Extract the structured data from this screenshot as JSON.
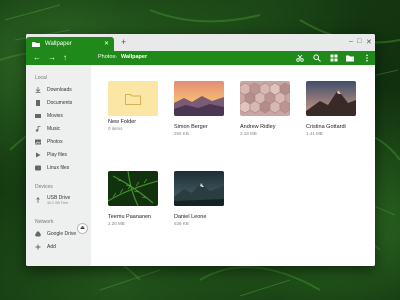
{
  "tab": {
    "title": "Wallpaper",
    "close": "✕"
  },
  "new_tab": "+",
  "window_controls": {
    "minimize": "–",
    "maximize": "□",
    "close": "✕"
  },
  "toolbar": {
    "back": "←",
    "forward": "→",
    "up": "↑",
    "breadcrumbs": [
      "Photos",
      "Wallpaper"
    ],
    "sep": "›"
  },
  "sidebar": {
    "local_label": "Local",
    "local_items": [
      "Downloads",
      "Documents",
      "Movies",
      "Music",
      "Photos",
      "Play files",
      "Linux files"
    ],
    "devices_label": "Devices",
    "usb": {
      "label": "USB Drive",
      "sub": "30.2 GB Free",
      "eject": "⏏"
    },
    "network_label": "Network",
    "network_items": [
      "Google Drive",
      "Add"
    ]
  },
  "files": [
    {
      "name": "New Folder",
      "size": "0 items"
    },
    {
      "name": "Simon Berger",
      "size": "255 KB"
    },
    {
      "name": "Andrew Ridley",
      "size": "2.18 MB"
    },
    {
      "name": "Cristina Gottardi",
      "size": "1.41 MB"
    },
    {
      "name": "Teemu Paananen",
      "size": "2.20 MB"
    },
    {
      "name": "Daniel Leone",
      "size": "636 KB"
    }
  ],
  "colors": {
    "accent": "#1f8a19"
  }
}
